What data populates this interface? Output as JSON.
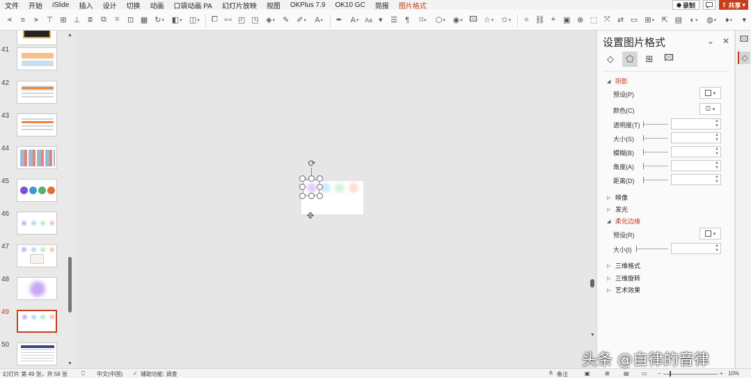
{
  "menu": {
    "items": [
      "文件",
      "开始",
      "iSlide",
      "插入",
      "设计",
      "切换",
      "动画",
      "口袋动画 PA",
      "幻灯片放映",
      "视图",
      "OKPlus 7.9",
      "OK10 GC",
      "简报",
      "图片格式"
    ],
    "active_index": 13,
    "record_label": "录制",
    "share_label": "共享"
  },
  "toolbar": {
    "font_size_label": "Aa"
  },
  "thumbnails": [
    {
      "number": "41"
    },
    {
      "number": "42"
    },
    {
      "number": "43"
    },
    {
      "number": "44"
    },
    {
      "number": "45"
    },
    {
      "number": "46"
    },
    {
      "number": "47"
    },
    {
      "number": "48"
    },
    {
      "number": "49",
      "selected": true
    },
    {
      "number": "50"
    }
  ],
  "format_pane": {
    "title": "设置图片格式",
    "sections": {
      "shadow": "阴影",
      "reflection": "映像",
      "glow": "发光",
      "soft_edges": "柔化边缘",
      "three_d_format": "三维格式",
      "three_d_rotation": "三维旋转",
      "artistic_effects": "艺术效果"
    },
    "shadow_rows": {
      "preset": "预设(P)",
      "color": "颜色(C)",
      "transparency": "透明度(T)",
      "size": "大小(S)",
      "blur": "模糊(B)",
      "angle": "角度(A)",
      "distance": "距离(D)"
    },
    "soft_edge_rows": {
      "preset": "预设(R)",
      "size": "大小(I)"
    }
  },
  "status": {
    "slide_info": "幻灯片 第 49 张，共 58 张",
    "language": "中文(中国)",
    "accessibility": "辅助功能: 调查",
    "notes": "备注",
    "zoom": "10%"
  },
  "watermark": "头条 @自律的音律",
  "colors": {
    "accent": "#c43e1c",
    "purple": "#7b4fd6",
    "blue": "#3b9bd8",
    "green": "#58b06a",
    "orange": "#e0703a"
  }
}
